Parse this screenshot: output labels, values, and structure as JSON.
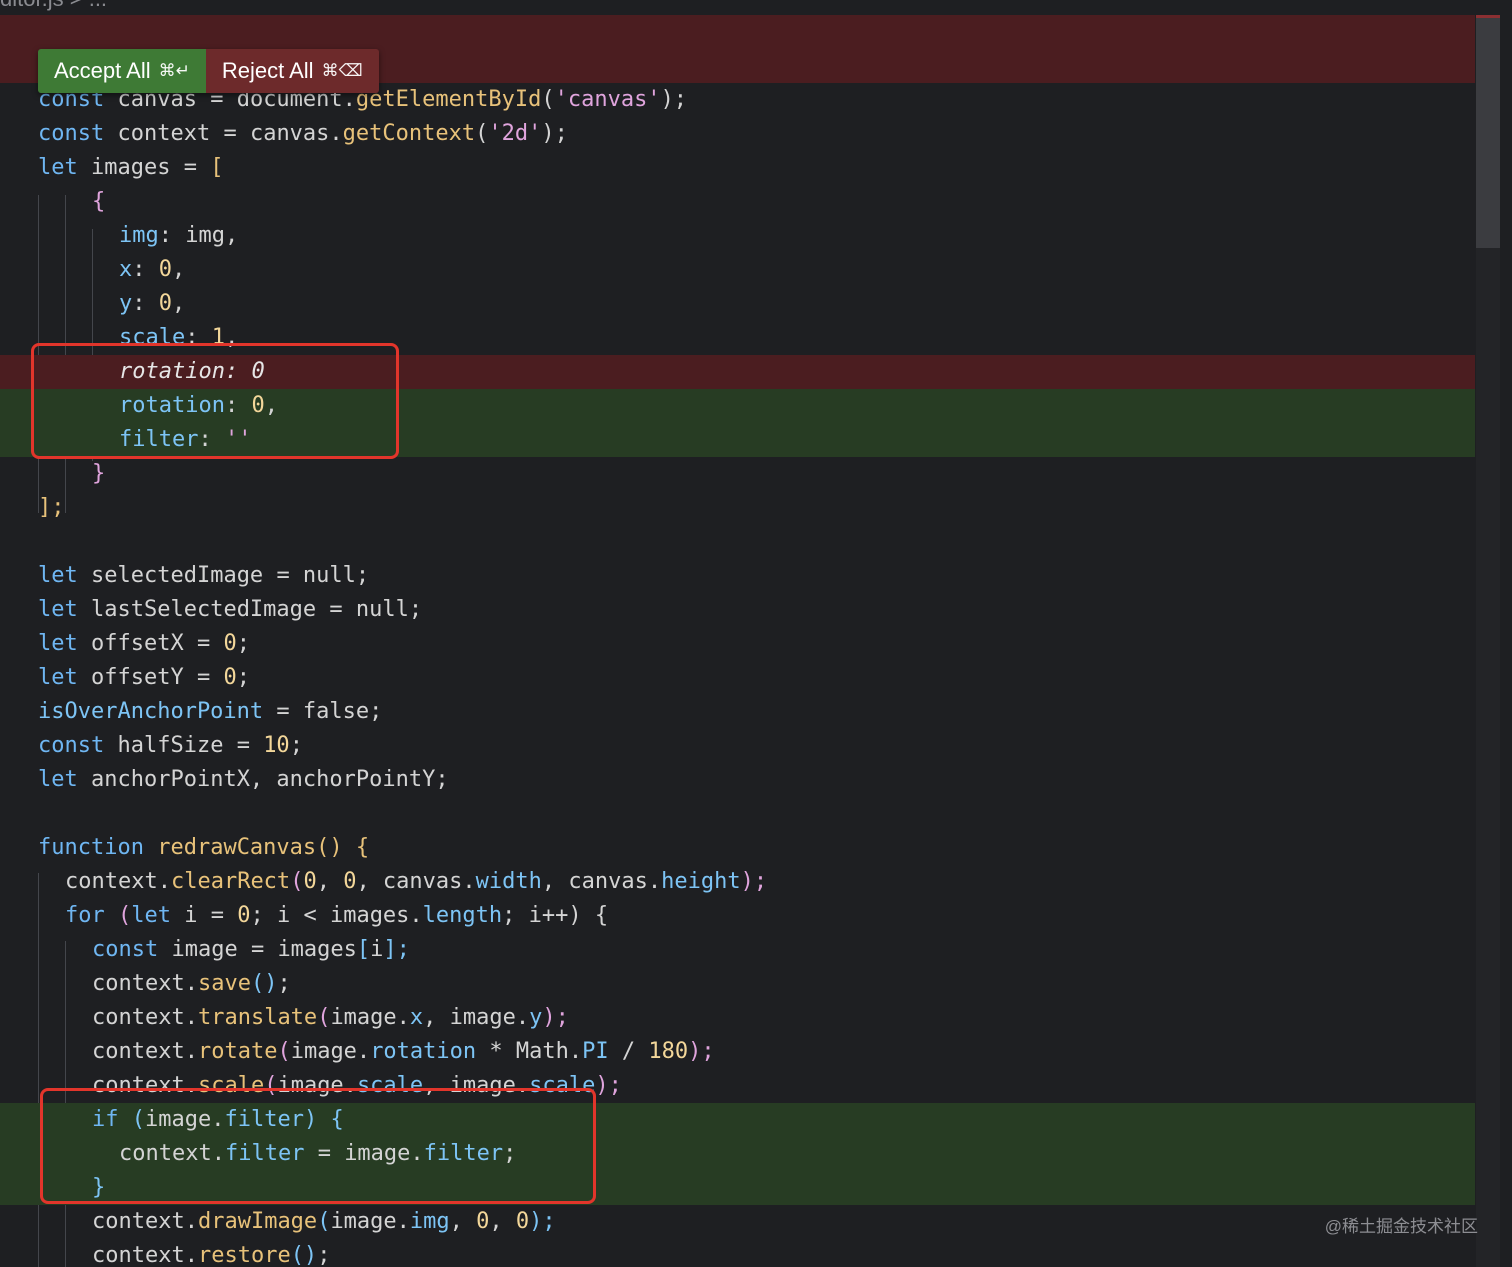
{
  "breadcrumb": {
    "file": "ditor.js",
    "separator": ">",
    "more": "..."
  },
  "diff_toolbar": {
    "accept_label": "Accept All",
    "accept_shortcut": "⌘↵",
    "reject_label": "Reject All",
    "reject_shortcut": "⌘⌫"
  },
  "code": {
    "l01": [
      "const",
      " canvas ",
      "=",
      " document.",
      "getElementById",
      "(",
      "'canvas'",
      ");"
    ],
    "l02": [
      "const",
      " context ",
      "=",
      " canvas.",
      "getContext",
      "(",
      "'2d'",
      ");"
    ],
    "l03": [
      "let",
      " images ",
      "=",
      " ",
      "["
    ],
    "l04": [
      "{"
    ],
    "l05": [
      "img",
      ": img,"
    ],
    "l06": [
      "x",
      ": ",
      "0",
      ","
    ],
    "l07": [
      "y",
      ": ",
      "0",
      ","
    ],
    "l08": [
      "scale",
      ": ",
      "1",
      ","
    ],
    "l09_deleted": "rotation: 0",
    "l10": [
      "rotation",
      ": ",
      "0",
      ","
    ],
    "l11": [
      "filter",
      ": ",
      "''"
    ],
    "l12": [
      "}"
    ],
    "l13": [
      "];"
    ],
    "l14": [
      "let",
      " selectedImage ",
      "=",
      " null;"
    ],
    "l15": [
      "let",
      " lastSelectedImage ",
      "=",
      " null;"
    ],
    "l16": [
      "let",
      " offsetX ",
      "=",
      " ",
      "0",
      ";"
    ],
    "l17": [
      "let",
      " offsetY ",
      "=",
      " ",
      "0",
      ";"
    ],
    "l18": [
      "isOverAnchorPoint",
      " = false;"
    ],
    "l19": [
      "const",
      " halfSize ",
      "=",
      " ",
      "10",
      ";"
    ],
    "l20": [
      "let",
      " anchorPointX, anchorPointY;"
    ],
    "l21": [
      "function",
      " ",
      "redrawCanvas",
      "()",
      " {"
    ],
    "l22": [
      "context.",
      "clearRect",
      "(",
      "0",
      ", ",
      "0",
      ", canvas.",
      "width",
      ", canvas.",
      "height",
      ");"
    ],
    "l23": [
      "for",
      " (",
      "let",
      " i = ",
      "0",
      "; i < images.",
      "length",
      "; i++) {"
    ],
    "l24": [
      "const",
      " image = images",
      "[",
      "i",
      "];"
    ],
    "l25": [
      "context.",
      "save",
      "()",
      ";"
    ],
    "l26": [
      "context.",
      "translate",
      "(",
      "image.",
      "x",
      ", image.",
      "y",
      ");"
    ],
    "l27": [
      "context.",
      "rotate",
      "(",
      "image.",
      "rotation",
      " * Math.",
      "PI",
      " / ",
      "180",
      ");"
    ],
    "l28": [
      "context.",
      "scale",
      "(",
      "image.",
      "scale",
      ", image.",
      "scale",
      ");"
    ],
    "l29": [
      "if",
      " (",
      "image.",
      "filter",
      ") {"
    ],
    "l30": [
      "context.",
      "filter",
      " = image.",
      "filter",
      ";"
    ],
    "l31": [
      "}"
    ],
    "l32": [
      "context.",
      "drawImage",
      "(",
      "image.",
      "img",
      ", ",
      "0",
      ", ",
      "0",
      ");"
    ],
    "l33": [
      "context.",
      "restore",
      "()",
      ";"
    ]
  },
  "colors": {
    "background": "#1e1f22",
    "deleted_line": "#4b1d20",
    "added_line": "#273c23",
    "accept_button": "#3e7a35",
    "reject_button": "#6d2a2b",
    "highlight_box": "#e2352b"
  },
  "watermark": "@稀土掘金技术社区"
}
